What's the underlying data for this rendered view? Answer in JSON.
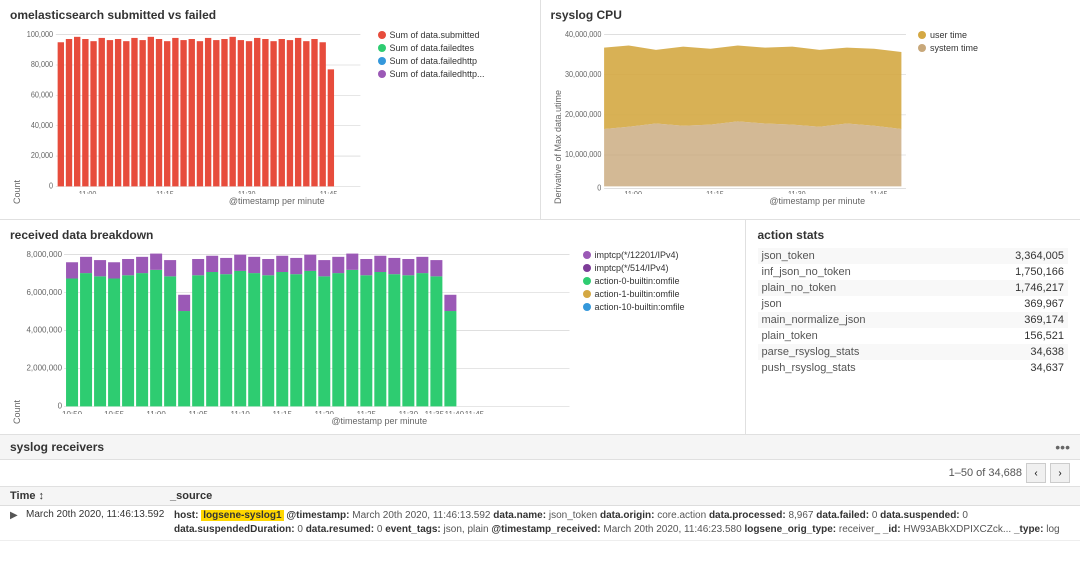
{
  "charts": {
    "submitted_failed": {
      "title": "omelasticsearch submitted vs failed",
      "y_label": "Count",
      "x_label": "@timestamp per minute",
      "legend": [
        {
          "color": "#e74c3c",
          "label": "Sum of data.submitted"
        },
        {
          "color": "#2ecc71",
          "label": "Sum of data.failedtes"
        },
        {
          "color": "#3498db",
          "label": "Sum of data.failedhttp"
        },
        {
          "color": "#9b59b6",
          "label": "Sum of data.failedhttp..."
        }
      ],
      "y_ticks": [
        "100,000",
        "80,000",
        "60,000",
        "40,000",
        "20,000",
        "0"
      ],
      "x_ticks": [
        "11:00",
        "11:15",
        "11:30",
        "11:45"
      ]
    },
    "rsyslog_cpu": {
      "title": "rsyslog CPU",
      "y_label": "Derivative of Max data.utime",
      "x_label": "@timestamp per minute",
      "legend": [
        {
          "color": "#d4a843",
          "label": "user time"
        },
        {
          "color": "#b8a060",
          "label": "system time"
        }
      ],
      "y_ticks": [
        "40,000,000",
        "30,000,000",
        "20,000,000",
        "10,000,000",
        "0"
      ],
      "x_ticks": [
        "11:00",
        "11:15",
        "11:30",
        "11:45"
      ]
    },
    "breakdown": {
      "title": "received data breakdown",
      "y_label": "Count",
      "x_label": "@timestamp per minute",
      "legend": [
        {
          "color": "#9b59b6",
          "label": "imptcp(*/12201/IPv4)"
        },
        {
          "color": "#9b59b6",
          "label": "imptcp(*/514/IPv4)"
        },
        {
          "color": "#2ecc71",
          "label": "action-0-builtin:omfile"
        },
        {
          "color": "#d4a843",
          "label": "action-1-builtin:omfile"
        },
        {
          "color": "#3498db",
          "label": "action-10-builtin:omfile"
        }
      ],
      "y_ticks": [
        "8,000,000",
        "6,000,000",
        "4,000,000",
        "2,000,000",
        "0"
      ],
      "x_ticks": [
        "10:50",
        "10:55",
        "11:00",
        "11:05",
        "11:10",
        "11:15",
        "11:20",
        "11:25",
        "11:30",
        "11:35",
        "11:40",
        "11:45"
      ]
    }
  },
  "action_stats": {
    "title": "action stats",
    "rows": [
      {
        "name": "json_token",
        "value": "3,364,005"
      },
      {
        "name": "inf_json_no_token",
        "value": "1,750,166"
      },
      {
        "name": "plain_no_token",
        "value": "1,746,217"
      },
      {
        "name": "json",
        "value": "369,967"
      },
      {
        "name": "main_normalize_json",
        "value": "369,174"
      },
      {
        "name": "plain_token",
        "value": "156,521"
      },
      {
        "name": "parse_rsyslog_stats",
        "value": "34,638"
      },
      {
        "name": "push_rsyslog_stats",
        "value": "34,637"
      }
    ]
  },
  "syslog_receivers": {
    "title": "syslog receivers",
    "pagination": {
      "text": "1–50 of 34,688"
    },
    "columns": [
      "Time",
      "_source"
    ],
    "rows": [
      {
        "time": "March 20th 2020, 11:46:13.592",
        "host_highlight": "logsene-syslog1",
        "source": "host: logsene-syslog1 @timestamp: March 20th 2020, 11:46:13.592 data.name: json_token data.origin: core.action data.processed: 8,967 data.failed: 0 data.suspended: 0 data.suspendedDuration: 0 data.resumed: 0 event_tags: json, plain @timestamp_received: March 20th 2020, 11:46:23.580 logsene_orig_type: receiver_ id: HW93ABkXDPIXCZck... type: log"
      }
    ]
  },
  "dots_menu": "•••"
}
